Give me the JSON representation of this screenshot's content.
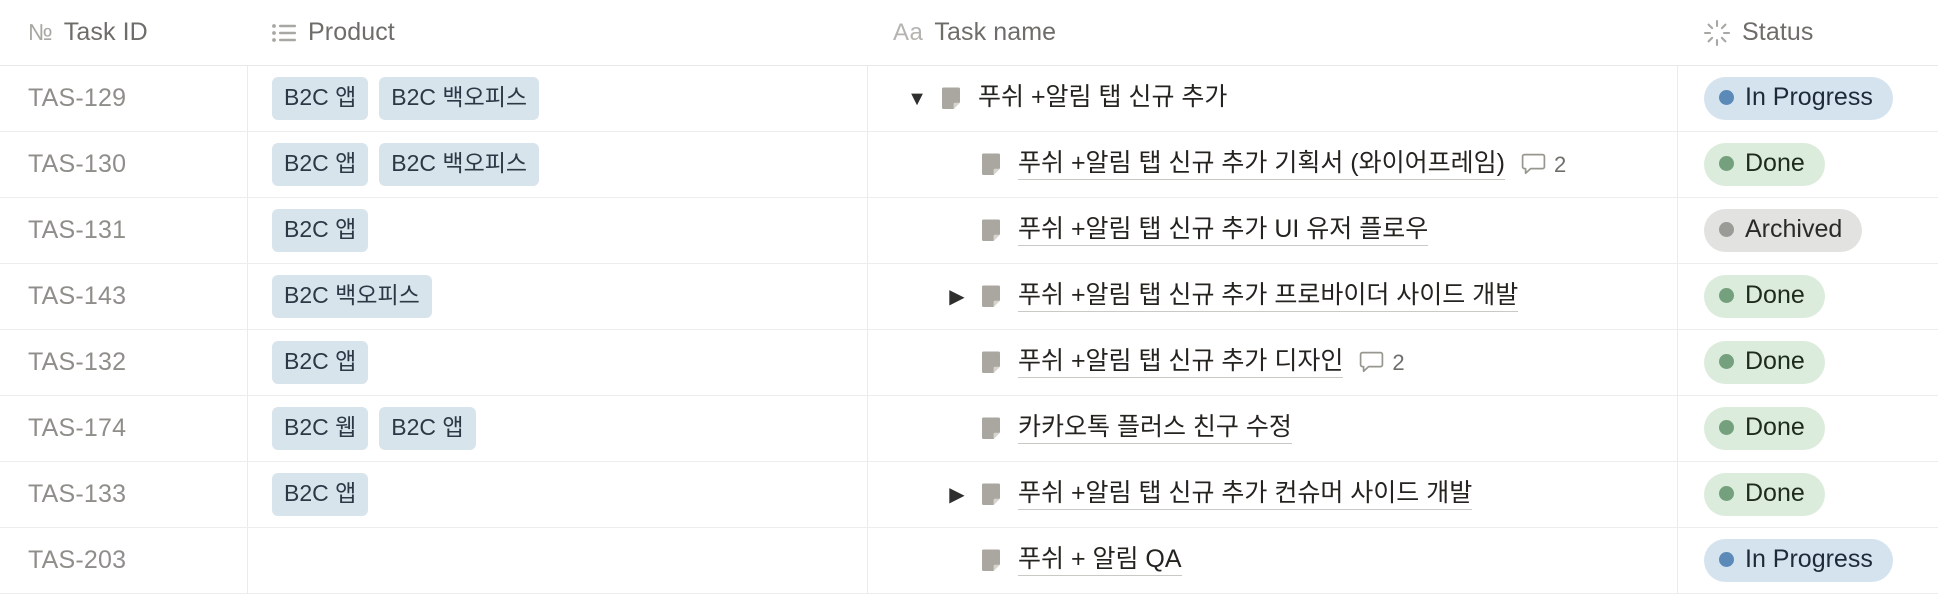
{
  "columns": [
    {
      "key": "task_id",
      "label": "Task ID",
      "icon": "number-icon"
    },
    {
      "key": "product",
      "label": "Product",
      "icon": "list-icon"
    },
    {
      "key": "task_name",
      "label": "Task name",
      "icon": "text-aa-icon"
    },
    {
      "key": "status",
      "label": "Status",
      "icon": "status-spinner-icon"
    }
  ],
  "colors": {
    "tag_bg": "#d7e4ec",
    "tag_text": "#2c3845",
    "status_in_progress_bg": "#d5e3ef",
    "status_in_progress_dot": "#5c8ab8",
    "status_done_bg": "#dcecdc",
    "status_done_dot": "#74a07d",
    "status_archived_bg": "#e2e2e0",
    "status_archived_dot": "#9a9a96",
    "row_border": "#ededed",
    "header_text": "#73726e",
    "task_id_text": "#8f8e8a"
  },
  "rows": [
    {
      "task_id": "TAS-129",
      "products": [
        "B2C 앱",
        "B2C 백오피스"
      ],
      "twisty": "expanded",
      "indent": 0,
      "name": "푸쉬 +알림 탭 신규 추가",
      "underline": false,
      "comments": null,
      "status": {
        "label": "In Progress",
        "type": "inprogress"
      }
    },
    {
      "task_id": "TAS-130",
      "products": [
        "B2C 앱",
        "B2C 백오피스"
      ],
      "twisty": "none",
      "indent": 1,
      "name": "푸쉬 +알림 탭 신규 추가 기획서 (와이어프레임)",
      "underline": true,
      "comments": "2",
      "status": {
        "label": "Done",
        "type": "done"
      }
    },
    {
      "task_id": "TAS-131",
      "products": [
        "B2C 앱"
      ],
      "twisty": "none",
      "indent": 1,
      "name": "푸쉬 +알림 탭 신규 추가 UI 유저 플로우",
      "underline": true,
      "comments": null,
      "status": {
        "label": "Archived",
        "type": "archived"
      }
    },
    {
      "task_id": "TAS-143",
      "products": [
        "B2C 백오피스"
      ],
      "twisty": "collapsed",
      "indent": 1,
      "name": "푸쉬 +알림 탭 신규 추가 프로바이더 사이드 개발",
      "underline": true,
      "comments": null,
      "status": {
        "label": "Done",
        "type": "done"
      }
    },
    {
      "task_id": "TAS-132",
      "products": [
        "B2C 앱"
      ],
      "twisty": "none",
      "indent": 1,
      "name": "푸쉬 +알림 탭 신규 추가 디자인",
      "underline": true,
      "comments": "2",
      "status": {
        "label": "Done",
        "type": "done"
      }
    },
    {
      "task_id": "TAS-174",
      "products": [
        "B2C 웹",
        "B2C 앱"
      ],
      "twisty": "none",
      "indent": 1,
      "name": "카카오톡 플러스 친구 수정",
      "underline": true,
      "comments": null,
      "status": {
        "label": "Done",
        "type": "done"
      }
    },
    {
      "task_id": "TAS-133",
      "products": [
        "B2C 앱"
      ],
      "twisty": "collapsed",
      "indent": 1,
      "name": "푸쉬 +알림 탭 신규 추가 컨슈머 사이드 개발",
      "underline": true,
      "comments": null,
      "status": {
        "label": "Done",
        "type": "done"
      }
    },
    {
      "task_id": "TAS-203",
      "products": [],
      "twisty": "none",
      "indent": 1,
      "name": "푸쉬 + 알림 QA",
      "underline": true,
      "comments": null,
      "status": {
        "label": "In Progress",
        "type": "inprogress"
      }
    }
  ],
  "glyphs": {
    "number_icon": "№",
    "aa_icon": "Aa",
    "twisty_expanded": "▼",
    "twisty_collapsed": "▶"
  }
}
